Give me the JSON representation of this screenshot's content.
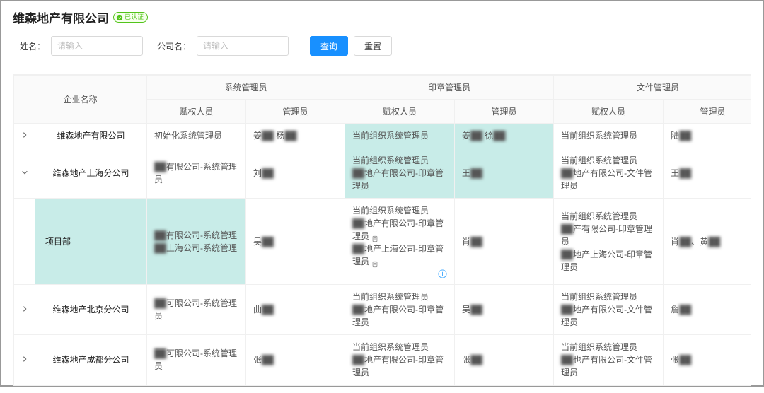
{
  "title": "维森地产有限公司",
  "verified_badge": "已认证",
  "form": {
    "name_label": "姓名：",
    "name_placeholder": "请输入",
    "company_label": "公司名：",
    "company_placeholder": "请输入",
    "search_btn": "查询",
    "reset_btn": "重置"
  },
  "headers": {
    "company": "企业名称",
    "sys_group": "系统管理员",
    "seal_group": "印章管理员",
    "file_group": "文件管理员",
    "grantor": "赋权人员",
    "admin": "管理员"
  },
  "rows": [
    {
      "expanded": false,
      "has_expander": true,
      "highlight_sys": false,
      "highlight_seal": true,
      "name": "维森地产有限公司",
      "sys_grantor": "初始化系统管理员",
      "sys_admin_html": "姜<span class='blur'>██</span>&nbsp;杨<span class='blur'>██</span>",
      "seal_grantor": "当前组织系统管理员",
      "seal_admin_html": "姜<span class='blur'>██</span>&nbsp;徐<span class='blur'>██</span>",
      "file_grantor": "当前组织系统管理员",
      "file_admin_html": "陆<span class='blur'>██</span>"
    },
    {
      "expanded": true,
      "has_expander": true,
      "highlight_sys": false,
      "highlight_seal": true,
      "name": "维森地产上海分公司",
      "sys_grantor_html": "<span class='blur'>██</span>有限公司-系统管理员",
      "sys_admin_html": "刘<span class='blur'>██</span>",
      "seal_grantor_html": "当前组织系统管理员<br><span class='blur'>██</span>地产有限公司-印章管理员",
      "seal_admin_html": "王<span class='blur'>██</span>",
      "file_grantor_html": "当前组织系统管理员<br><span class='blur'>██</span>地产有限公司-文件管理员",
      "file_admin_html": "王<span class='blur'>██</span>"
    },
    {
      "expanded": null,
      "has_expander": false,
      "child": true,
      "highlight_sys": true,
      "highlight_seal": false,
      "name": "项目部",
      "sys_grantor_html": "<span class='blur'>██</span>有限公司-系统管理<br><span class='blur'>██</span>上海公司-系统管理",
      "sys_admin_html": "吴<span class='blur'>██</span>",
      "seal_grantor_html": "当前组织系统管理员<br><span class='blur'>██</span>地产有限公司-印章管理员 <span class='micro-icon' data-name='page-icon' data-interactable='false'><svg viewBox='0 0 12 12'><rect x='2.5' y='1.5' width='7' height='9' rx='1'/><path d='M4.5 4h3M4.5 6h3'/></svg></span><br><span class='blur'>██</span>地产上海公司-印章管理员 <span class='micro-icon' data-name='page-icon' data-interactable='false'><svg viewBox='0 0 12 12'><rect x='2.5' y='1.5' width='7' height='9' rx='1'/><path d='M4.5 4h3M4.5 6h3'/></svg></span><br><span class='plus-circle' data-name='add-circle-icon' data-interactable='true'><svg viewBox='0 0 14 14'><circle cx='7' cy='7' r='6' fill='none' stroke='#40a9ff'/><path d='M7 4v6M4 7h6' stroke='#40a9ff'/></svg></span>",
      "seal_admin_html": "肖<span class='blur'>██</span>",
      "file_grantor_html": "当前组织系统管理员<br><span class='blur'>██</span>产有限公司-印章管理员<br><span class='blur'>██</span>地产上海公司-印章管理员",
      "file_admin_html": "肖<span class='blur'>██</span>、黄<span class='blur'>██</span>"
    },
    {
      "expanded": false,
      "has_expander": true,
      "highlight_sys": false,
      "highlight_seal": false,
      "name": "维森地产北京分公司",
      "sys_grantor_html": "<span class='blur'>██</span>可限公司-系统管理员",
      "sys_admin_html": "曲<span class='blur'>██</span>",
      "seal_grantor_html": "当前组织系统管理员<br><span class='blur'>██</span>地产有限公司-印章管理员",
      "seal_admin_html": "吴<span class='blur'>██</span>",
      "file_grantor_html": "当前组织系统管理员<br><span class='blur'>██</span>地产有限公司-文件管理员",
      "file_admin_html": "詹<span class='blur'>██</span>"
    },
    {
      "expanded": false,
      "has_expander": true,
      "highlight_sys": false,
      "highlight_seal": false,
      "name": "维森地产成都分公司",
      "sys_grantor_html": "<span class='blur'>██</span>可限公司-系统管理员",
      "sys_admin_html": "张<span class='blur'>██</span>",
      "seal_grantor_html": "当前组织系统管理员<br><span class='blur'>██</span>地产有限公司-印章管理员",
      "seal_admin_html": "张<span class='blur'>██</span>",
      "file_grantor_html": "当前组织系统管理员<br><span class='blur'>██</span>也产有限公司-文件管理员",
      "file_admin_html": "张<span class='blur'>██</span>"
    }
  ]
}
